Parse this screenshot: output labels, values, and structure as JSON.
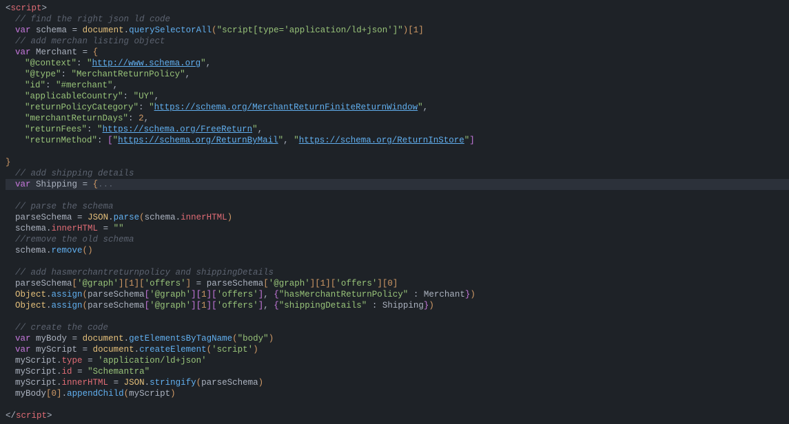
{
  "code": {
    "tag_open": "<",
    "tag_close": ">",
    "script_tag": "script",
    "end_script": "</",
    "comments": {
      "find_json": "// find the right json ld code",
      "add_merchant": "// add merchan listing object",
      "add_shipping": "// add shipping details",
      "parse_schema": "// parse the schema",
      "remove_old": "//remove the old schema",
      "add_policy": "// add hasmerchantreturnpolicy and shippingDetails",
      "create_code": "// create the code"
    },
    "keywords": {
      "var": "var"
    },
    "vars": {
      "schema": "schema",
      "Merchant": "Merchant",
      "Shipping": "Shipping",
      "parseSchema": "parseSchema",
      "myBody": "myBody",
      "myScript": "myScript"
    },
    "objects": {
      "document": "document",
      "JSON": "JSON",
      "Object": "Object"
    },
    "methods": {
      "querySelectorAll": "querySelectorAll",
      "parse": "parse",
      "remove": "remove",
      "assign": "assign",
      "getElementsByTagName": "getElementsByTagName",
      "createElement": "createElement",
      "stringify": "stringify",
      "appendChild": "appendChild"
    },
    "props": {
      "innerHTML": "innerHTML",
      "type": "type",
      "id": "id"
    },
    "strings": {
      "selector": "\"script[type='application/ld+json']\"",
      "context_key": "\"@context\"",
      "schema_url": "http://www.schema.org",
      "type_key": "\"@type\"",
      "type_val": "\"MerchantReturnPolicy\"",
      "id_key": "\"id\"",
      "id_val": "\"#merchant\"",
      "country_key": "\"applicableCountry\"",
      "country_val": "\"UY\"",
      "policy_cat_key": "\"returnPolicyCategory\"",
      "policy_cat_url": "https://schema.org/MerchantReturnFiniteReturnWindow",
      "return_days_key": "\"merchantReturnDays\"",
      "return_fees_key": "\"returnFees\"",
      "free_return_url": "https://schema.org/FreeReturn",
      "return_method_key": "\"returnMethod\"",
      "return_mail_url": "https://schema.org/ReturnByMail",
      "return_store_url": "https://schema.org/ReturnInStore",
      "empty": "\"\"",
      "graph": "'@graph'",
      "offers": "'offers'",
      "hasMerchant": "\"hasMerchantReturnPolicy\"",
      "shippingDetails": "\"shippingDetails\"",
      "body": "\"body\"",
      "script_str": "'script'",
      "appjson": "'application/ld+json'",
      "schemantra": "\"Schemantra\""
    },
    "numbers": {
      "one": "1",
      "two": "2",
      "zero": "0"
    },
    "fold": "..."
  }
}
